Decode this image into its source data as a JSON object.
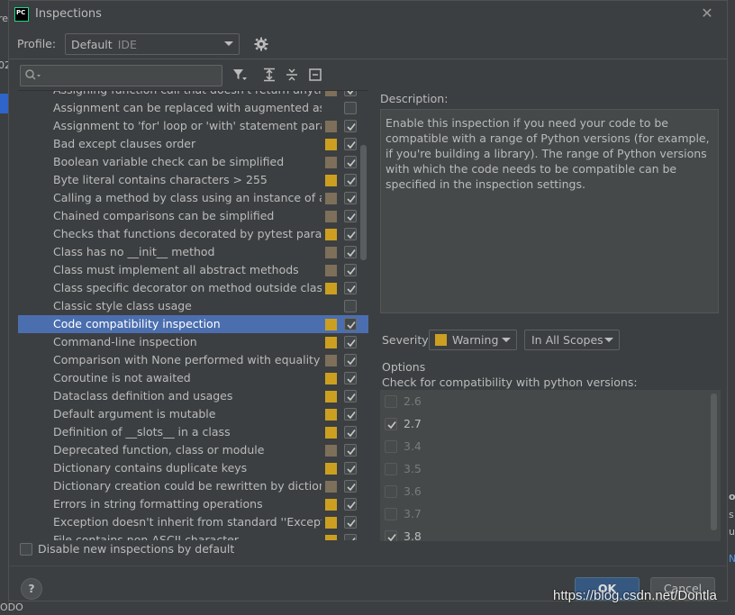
{
  "window": {
    "app_icon_text": "PC",
    "title": "Inspections",
    "close_glyph": "✕"
  },
  "profile": {
    "label": "Profile:",
    "value": "Default",
    "scope_tag": "IDE"
  },
  "search": {
    "value": "",
    "placeholder": ""
  },
  "inspections": [
    {
      "name": "Assigning function call that doesn't return anything",
      "severity": "weak",
      "checked": true
    },
    {
      "name": "Assignment can be replaced with augmented assignment",
      "severity": "none",
      "checked": false
    },
    {
      "name": "Assignment to 'for' loop or 'with' statement parameter",
      "severity": "weak",
      "checked": true
    },
    {
      "name": "Bad except clauses order",
      "severity": "warning",
      "checked": true
    },
    {
      "name": "Boolean variable check can be simplified",
      "severity": "weak",
      "checked": true
    },
    {
      "name": "Byte literal contains characters > 255",
      "severity": "warning",
      "checked": true
    },
    {
      "name": "Calling a method by class using an instance of a different class",
      "severity": "weak",
      "checked": true
    },
    {
      "name": "Chained comparisons can be simplified",
      "severity": "weak",
      "checked": true
    },
    {
      "name": "Checks that functions decorated by pytest parametrize",
      "severity": "warning",
      "checked": true
    },
    {
      "name": "Class has no __init__ method",
      "severity": "weak",
      "checked": true
    },
    {
      "name": "Class must implement all abstract methods",
      "severity": "weak",
      "checked": true
    },
    {
      "name": "Class specific decorator on method outside class",
      "severity": "warning",
      "checked": true
    },
    {
      "name": "Classic style class usage",
      "severity": "none",
      "checked": false
    },
    {
      "name": "Code compatibility inspection",
      "severity": "warning",
      "checked": true,
      "selected": true
    },
    {
      "name": "Command-line inspection",
      "severity": "warning",
      "checked": true
    },
    {
      "name": "Comparison with None performed with equality operators",
      "severity": "weak",
      "checked": true
    },
    {
      "name": "Coroutine is not awaited",
      "severity": "warning",
      "checked": true
    },
    {
      "name": "Dataclass definition and usages",
      "severity": "warning",
      "checked": true
    },
    {
      "name": "Default argument is mutable",
      "severity": "warning",
      "checked": true
    },
    {
      "name": "Definition of __slots__ in a class",
      "severity": "warning",
      "checked": true
    },
    {
      "name": "Deprecated function, class or module",
      "severity": "weak",
      "checked": true
    },
    {
      "name": "Dictionary contains duplicate keys",
      "severity": "warning",
      "checked": true
    },
    {
      "name": "Dictionary creation could be rewritten by dictionary literal",
      "severity": "weak",
      "checked": true
    },
    {
      "name": "Errors in string formatting operations",
      "severity": "warning",
      "checked": true
    },
    {
      "name": "Exception doesn't inherit from standard ''Exception'' class",
      "severity": "warning",
      "checked": true
    },
    {
      "name": "File contains non-ASCII character",
      "severity": "warning",
      "checked": true
    }
  ],
  "severity_colors": {
    "warning": "#cc9f21",
    "weak": "#7d6f5a",
    "none": "transparent"
  },
  "disable_new": {
    "label": "Disable new inspections by default",
    "checked": false
  },
  "description": {
    "label": "Description:",
    "text": "Enable this inspection if you need your code to be compatible with a range of Python versions (for example, if you're building a library). The range of Python versions with which the code needs to be compatible can be specified in the inspection settings."
  },
  "severity": {
    "label": "Severity:",
    "value": "Warning",
    "color": "#cc9f21",
    "scope": "In All Scopes"
  },
  "options": {
    "label": "Options",
    "compat_label": "Check for compatibility with python versions:",
    "versions": [
      {
        "label": "2.6",
        "checked": false
      },
      {
        "label": "2.7",
        "checked": true
      },
      {
        "label": "3.4",
        "checked": false
      },
      {
        "label": "3.5",
        "checked": false
      },
      {
        "label": "3.6",
        "checked": false
      },
      {
        "label": "3.7",
        "checked": false
      },
      {
        "label": "3.8",
        "checked": true
      }
    ]
  },
  "buttons": {
    "help": "?",
    "ok": "OK",
    "cancel": "Cancel"
  },
  "background": {
    "left_texts": [
      "re",
      "02"
    ],
    "right_texts": [
      "o",
      "s",
      "u",
      "N"
    ],
    "bottom_text": "ODO"
  },
  "watermark": "https://blog.csdn.net/Dontla"
}
